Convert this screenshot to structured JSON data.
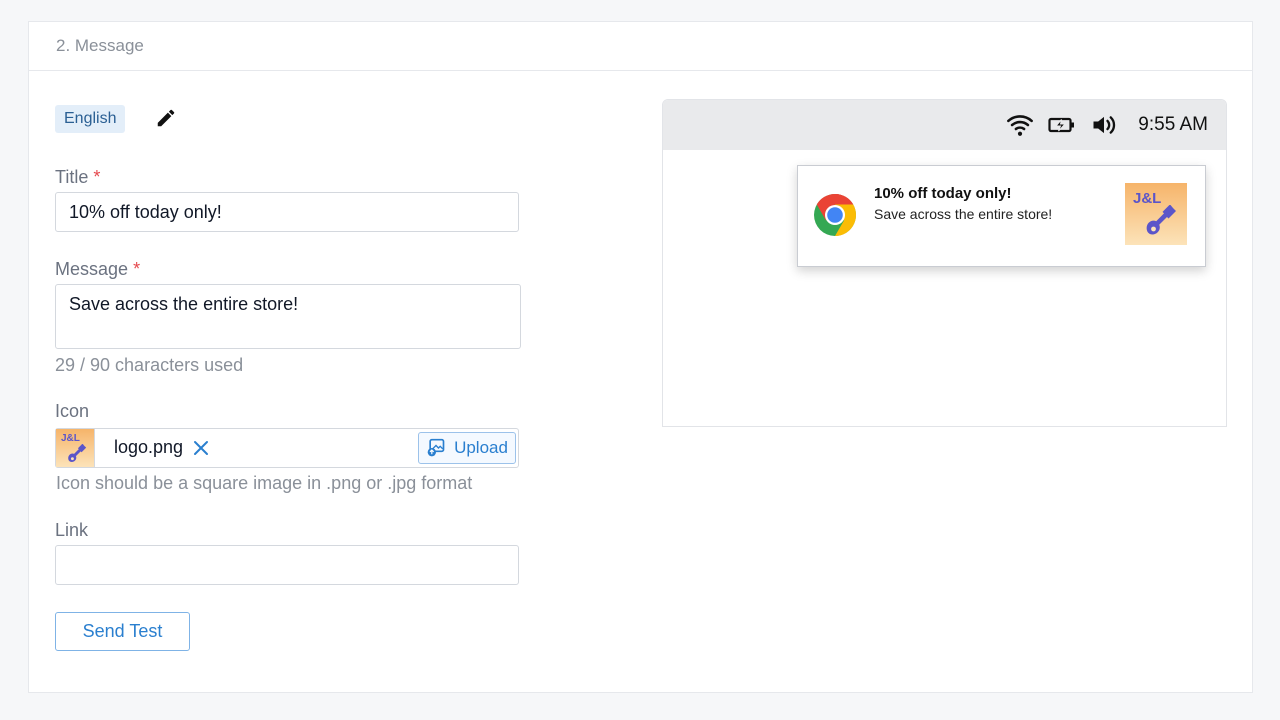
{
  "section": {
    "title": "2. Message"
  },
  "language": {
    "badge": "English"
  },
  "title_field": {
    "label": "Title",
    "required_mark": "*",
    "value": "10% off today only!"
  },
  "message_field": {
    "label": "Message",
    "required_mark": "*",
    "value": "Save across the entire store!",
    "counter": "29 / 90 characters used"
  },
  "icon_field": {
    "label": "Icon",
    "thumb_text": "J&L",
    "filename": "logo.png",
    "upload_label": "Upload",
    "help": "Icon should be a square image in .png or .jpg format"
  },
  "link_field": {
    "label": "Link",
    "value": ""
  },
  "send_test": {
    "label": "Send Test"
  },
  "preview": {
    "status_time": "9:55 AM",
    "status_icons": [
      "wifi-icon",
      "battery-charging-icon",
      "volume-icon"
    ],
    "notification": {
      "title": "10% off today only!",
      "body": "Save across the entire store!",
      "image_text": "J&L",
      "app_icon": "chrome-icon"
    }
  },
  "colors": {
    "accent": "#2a7fcf",
    "required": "#e5484d",
    "badge_bg": "#e3eef9",
    "brand_purple": "#5b55c9",
    "brand_orange": "#f6b46a"
  }
}
